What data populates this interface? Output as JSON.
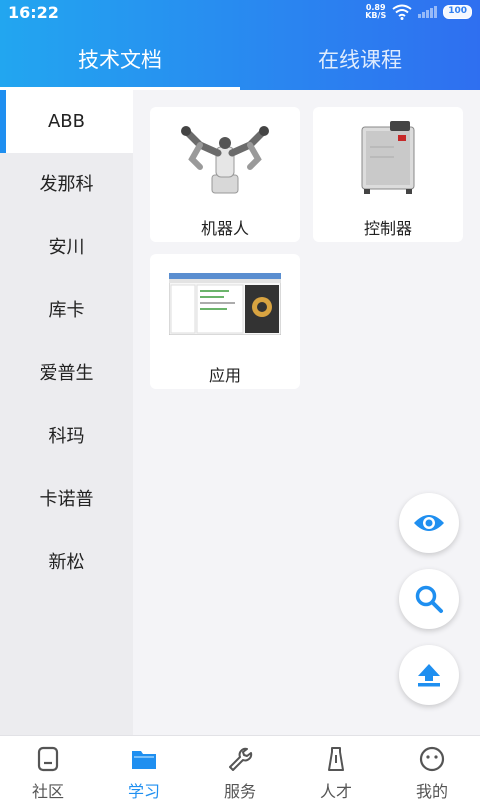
{
  "status_bar": {
    "time": "16:22",
    "speed_value": "0.89",
    "speed_unit": "KB/S",
    "battery": "100"
  },
  "top_tabs": [
    {
      "label": "技术文档",
      "active": true
    },
    {
      "label": "在线课程",
      "active": false
    }
  ],
  "sidebar": {
    "items": [
      {
        "label": "ABB",
        "active": true
      },
      {
        "label": "发那科"
      },
      {
        "label": "安川"
      },
      {
        "label": "库卡"
      },
      {
        "label": "爱普生"
      },
      {
        "label": "科玛"
      },
      {
        "label": "卡诺普"
      },
      {
        "label": "新松"
      }
    ]
  },
  "cards": [
    {
      "label": "机器人",
      "image": "robot-image"
    },
    {
      "label": "控制器",
      "image": "controller-image"
    },
    {
      "label": "应用",
      "image": "software-screenshot-image"
    }
  ],
  "fabs": [
    {
      "icon": "eye-icon"
    },
    {
      "icon": "search-icon"
    },
    {
      "icon": "upload-icon"
    }
  ],
  "bottom_nav": [
    {
      "label": "社区",
      "icon": "community-icon"
    },
    {
      "label": "学习",
      "icon": "folder-icon",
      "active": true
    },
    {
      "label": "服务",
      "icon": "wrench-icon"
    },
    {
      "label": "人才",
      "icon": "talent-icon"
    },
    {
      "label": "我的",
      "icon": "face-icon"
    }
  ],
  "colors": {
    "accent": "#1f8ff0",
    "header_start": "#22a6f0",
    "header_end": "#2f6ff0"
  }
}
